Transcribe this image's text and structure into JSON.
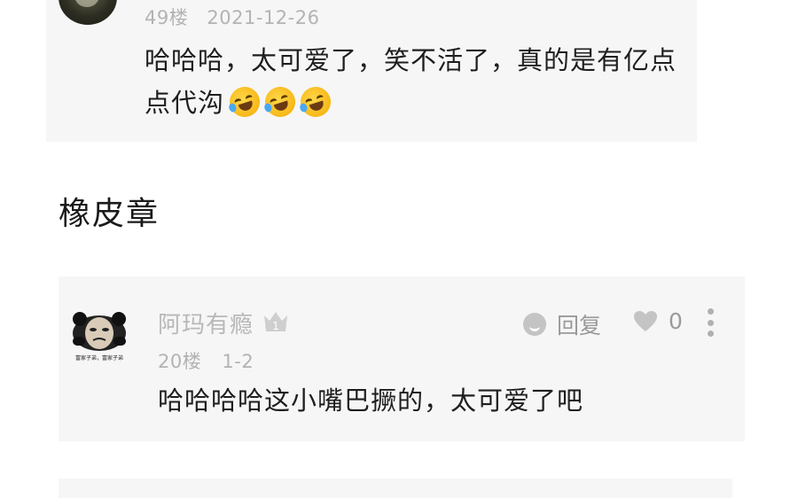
{
  "comments": [
    {
      "floor": "49楼",
      "date": "2021-12-26",
      "text_line1": "哈哈哈，太可爱了，笑不活了，真的是有亿点",
      "text_line2": "点代沟",
      "emoji_count": 3,
      "emoji": "rolling-on-floor-laughing-icon"
    },
    {
      "username": "阿玛有瘾",
      "badge_icon": "crown-icon",
      "badge_number": "1",
      "floor": "20楼",
      "date": "1-2",
      "reply_label": "回复",
      "like_count": "0",
      "avatar_caption": "富家子弟，富家子弟",
      "text": "哈哈哈哈这小嘴巴撅的，太可爱了吧"
    }
  ],
  "section": {
    "title": "橡皮章"
  },
  "colors": {
    "card_bg": "#f6f6f6",
    "meta_text": "#b3b3b3",
    "icon_gray": "#c4c4c4"
  }
}
